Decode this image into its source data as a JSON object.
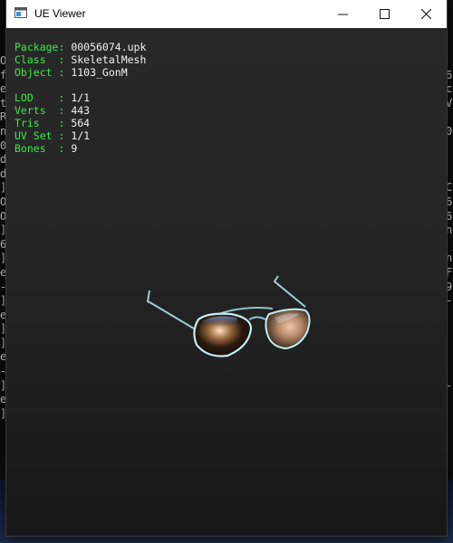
{
  "window": {
    "title": "UE Viewer"
  },
  "info_lines": [
    {
      "key": "Package: ",
      "value": "00056074.upk"
    },
    {
      "key": "Class  : ",
      "value": "SkeletalMesh"
    },
    {
      "key": "Object : ",
      "value": "1103_GonM"
    }
  ],
  "stats_lines": [
    {
      "key": "LOD    : ",
      "value": "1/1"
    },
    {
      "key": "Verts  : ",
      "value": "443"
    },
    {
      "key": "Tris   : ",
      "value": "564"
    },
    {
      "key": "UV Set : ",
      "value": "1/1"
    },
    {
      "key": "Bones  : ",
      "value": "9"
    }
  ],
  "background": {
    "left_console": "O\nf\ne\nt\nR\nn\n0\nd\nd\n]\nO\nO\n]\n6\n]\ne\n-\n]\ne\n]\n]\ne\n-\n]\ne\n]",
    "right_console": "\n6\nc\nV\n\n0\n\n\n\nC\n6\n6\nn\n\nn\nF\n9\n-\n\n\n\n\n\n-"
  },
  "icons": [
    "window-app-icon",
    "minimize-icon",
    "maximize-icon",
    "close-icon"
  ],
  "colors": {
    "label_green": "#3ee84a",
    "value_white": "#f2f2f2",
    "viewport_bg": "#262626"
  }
}
